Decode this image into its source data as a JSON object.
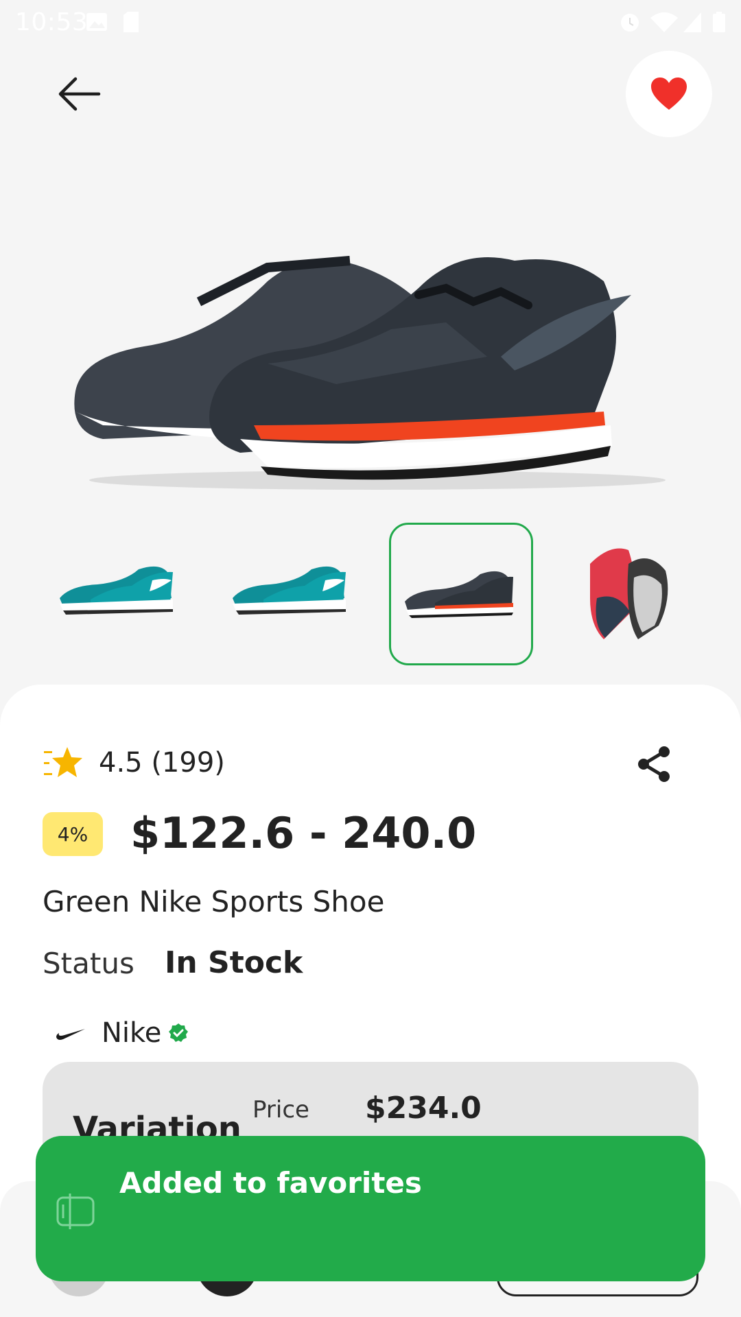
{
  "status_bar": {
    "time": "10:53",
    "icons": [
      "gallery-icon",
      "sd-card-icon",
      "alarm-icon",
      "wifi-icon",
      "signal-icon",
      "battery-icon"
    ]
  },
  "nav": {
    "back_icon": "arrow-left-icon",
    "favorite_icon": "heart-icon",
    "favorite_active": true
  },
  "gallery": {
    "thumbnails": [
      {
        "name": "green-shoe-1",
        "selected": false
      },
      {
        "name": "green-shoe-2",
        "selected": false
      },
      {
        "name": "dark-shoe",
        "selected": true
      },
      {
        "name": "red-shoe",
        "selected": false
      }
    ]
  },
  "product": {
    "rating_text": "4.5 (199)",
    "discount": "4%",
    "price_range": "$122.6 - 240.0",
    "name": "Green Nike Sports Shoe",
    "status_label": "Status",
    "status_value": "In Stock",
    "brand": "Nike",
    "brand_verified": true
  },
  "variation": {
    "title": "Variation",
    "price_label": "Price",
    "price_value": "$234.0"
  },
  "toast": {
    "message": "Added to favorites"
  },
  "colors": {
    "accent_green": "#22ab4a",
    "heart_red": "#f0302a",
    "badge_yellow": "#ffe872",
    "star_yellow": "#f7b500"
  }
}
